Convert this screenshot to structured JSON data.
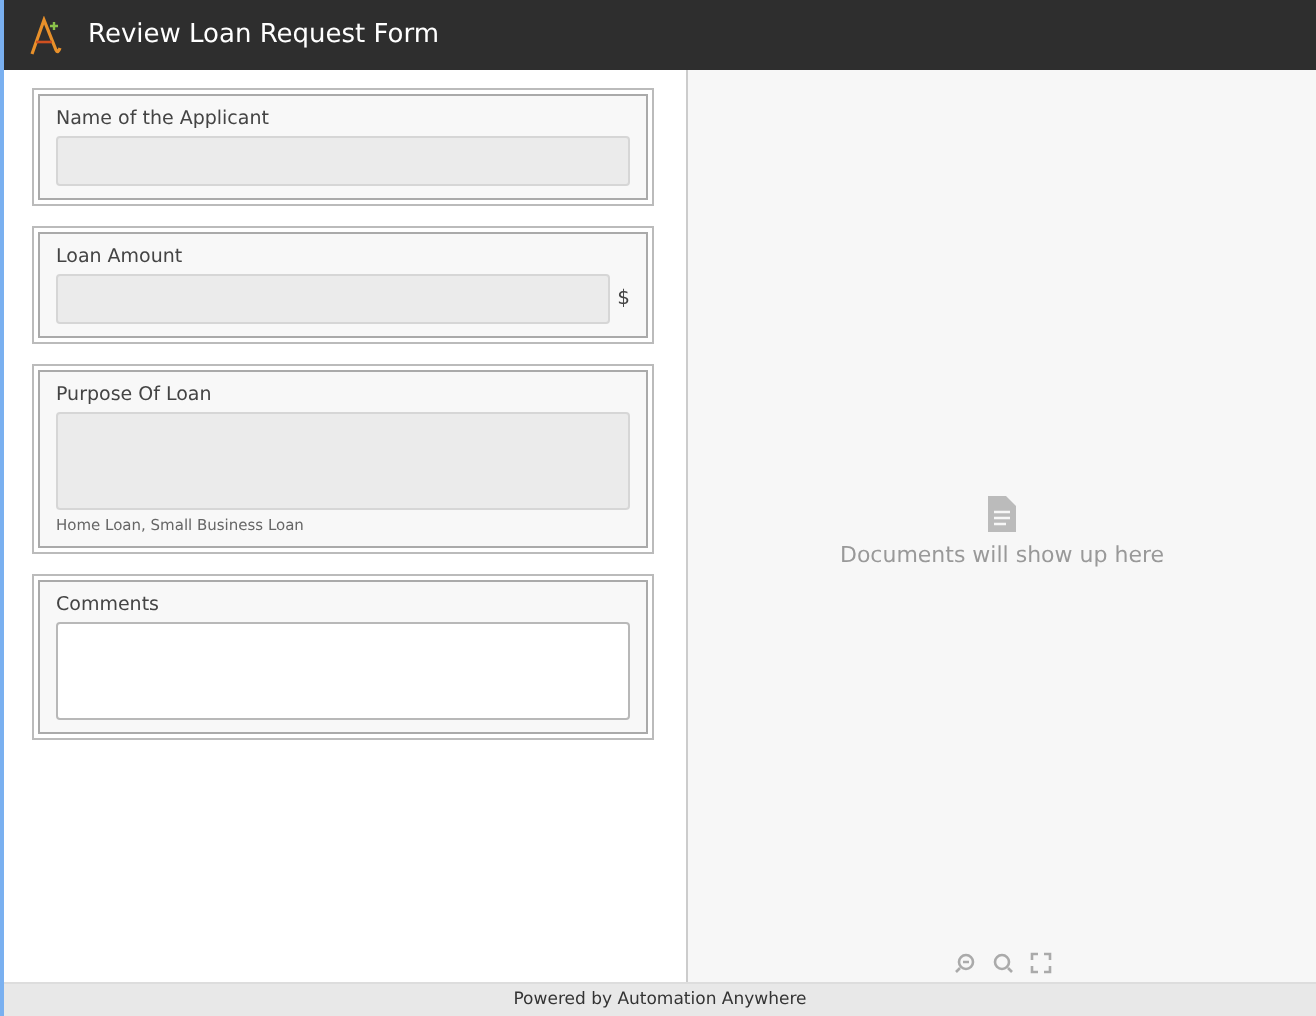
{
  "window": {
    "title": "Review Loan Request Form"
  },
  "fields": [
    {
      "label": "Name of the Applicant",
      "kind": "line",
      "disabled": true
    },
    {
      "label": "Loan Amount",
      "kind": "line",
      "disabled": true,
      "suffix": "$"
    },
    {
      "label": "Purpose Of Loan",
      "kind": "area",
      "disabled": true,
      "hint": "Home Loan, Small Business Loan"
    },
    {
      "label": "Comments",
      "kind": "area",
      "disabled": false
    }
  ],
  "viewer": {
    "message": "Documents will show up here"
  },
  "status_bar": "Powered by Automation Anywhere"
}
